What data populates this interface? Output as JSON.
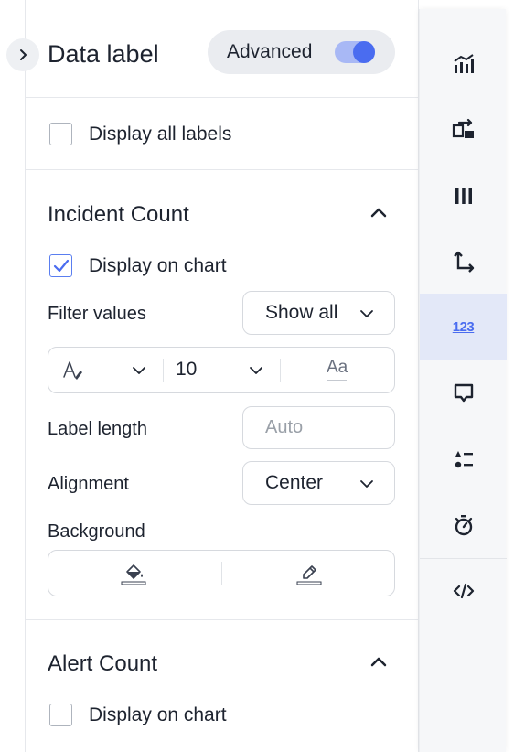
{
  "panel": {
    "title": "Data label",
    "advanced_label": "Advanced",
    "advanced_on": true,
    "display_all_label": "Display all labels",
    "display_all_checked": false
  },
  "incident": {
    "title": "Incident Count",
    "display_on_chart_label": "Display on chart",
    "display_on_chart_checked": true,
    "filter_label": "Filter values",
    "filter_value": "Show all",
    "font_size": "10",
    "case_glyph": "Aa",
    "label_length_label": "Label length",
    "label_length_placeholder": "Auto",
    "alignment_label": "Alignment",
    "alignment_value": "Center",
    "background_label": "Background"
  },
  "alert": {
    "title": "Alert Count",
    "display_on_chart_label": "Display on chart",
    "display_on_chart_checked": false
  },
  "rail": {
    "items": [
      {
        "icon": "chart-bar-line-icon"
      },
      {
        "icon": "swap-config-icon"
      },
      {
        "icon": "columns-icon"
      },
      {
        "icon": "axis-icon"
      },
      {
        "icon": "number-123-icon",
        "text": "123",
        "active": true
      },
      {
        "icon": "tooltip-icon"
      },
      {
        "icon": "sort-list-icon"
      },
      {
        "icon": "stopwatch-icon"
      },
      {
        "icon": "code-icon"
      }
    ]
  },
  "colors": {
    "accent": "#4a6cf0",
    "active_rail_bg": "#e3e8f8",
    "text": "#1d232f"
  }
}
